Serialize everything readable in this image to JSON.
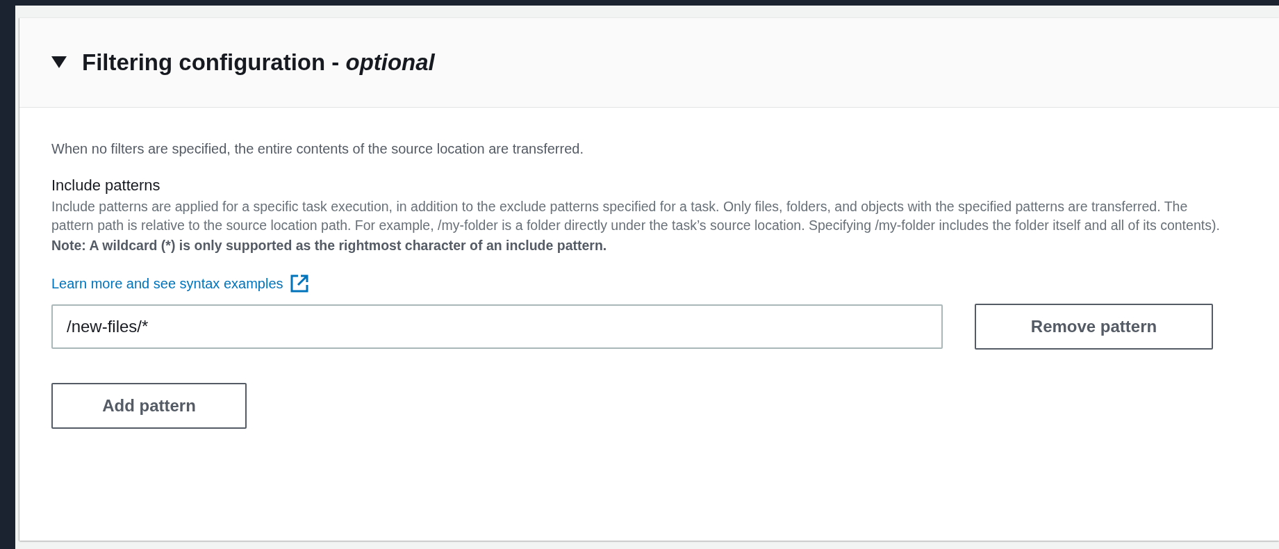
{
  "section": {
    "title": "Filtering configuration - *optional*",
    "expanded": true,
    "description": "When no filters are specified, the entire contents of the source location are transferred.",
    "include_patterns": {
      "label": "Include patterns",
      "help": "Include patterns are applied for a specific task execution, in addition to the exclude patterns specified for a task. Only files, folders, and objects with the specified patterns are transferred. The pattern path is relative to the source location path. For example, /my-folder is a folder directly under the task’s source location. Specifying /my-folder includes the folder itself and all of its contents).",
      "note": "Note: A wildcard (*) is only supported as the rightmost character of an include pattern.",
      "link": "Learn more and see syntax examples",
      "patterns": [
        {
          "value": "/new-files/*",
          "remove_label": "Remove pattern"
        }
      ],
      "add_label": "Add pattern"
    }
  }
}
